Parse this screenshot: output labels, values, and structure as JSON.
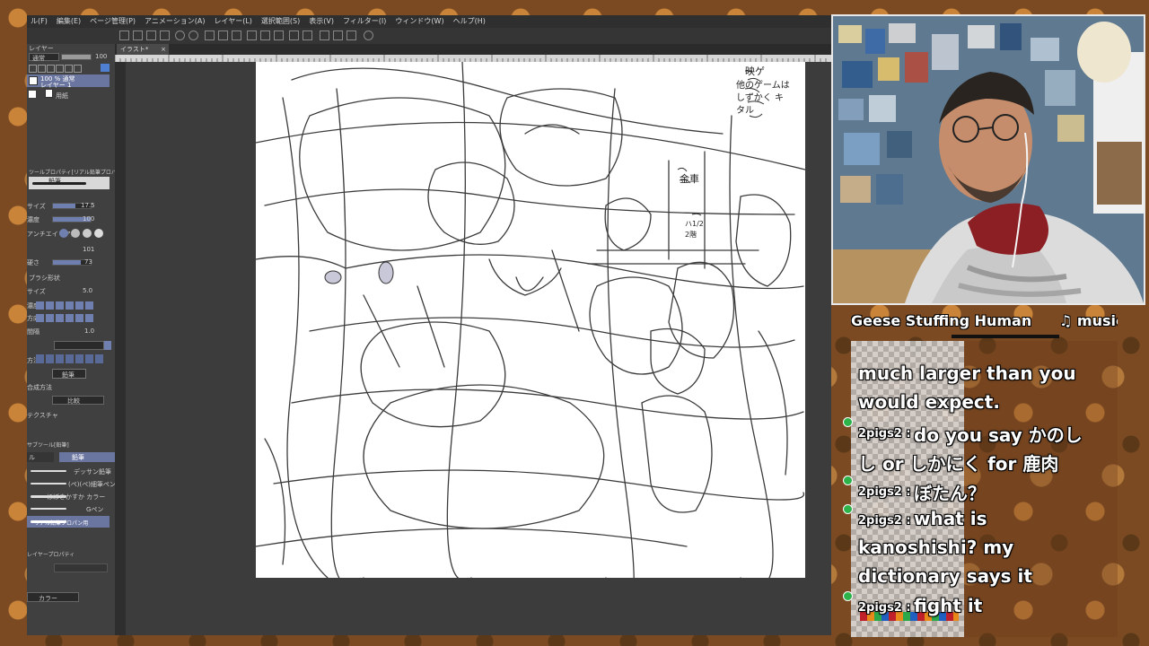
{
  "menu": {
    "items": [
      "ル(F)",
      "編集(E)",
      "ページ管理(P)",
      "アニメーション(A)",
      "レイヤー(L)",
      "選択範囲(S)",
      "表示(V)",
      "フィルター(I)",
      "ウィンドウ(W)",
      "ヘルプ(H)"
    ]
  },
  "document_tab": {
    "label": "イラスト*",
    "close": "×"
  },
  "left_panel": {
    "layer_header": "レイヤー",
    "blend_mode": "通常",
    "opacity_value": "100",
    "layer1_name": "100 % 通常",
    "layer1_sub": "レイヤー 1",
    "layer2_name": "用紙",
    "tool_property_header": "ツールプロパティ[リアル鉛筆プロパ...]",
    "brush_name": "鉛筆",
    "size_label": "サイズ",
    "size_value": "17.5",
    "density_label": "濃度",
    "density_value": "100",
    "anti_label": "アンチエイリアス",
    "val_101": "101",
    "hardness_label": "硬さ",
    "hardness_value": "73",
    "stabilize_label": "ブラシ形状",
    "size2_label": "サイズ",
    "size2_value": "5.0",
    "density2_label": "濃度",
    "direction_label": "方向",
    "interval_label": "間隔",
    "interval_value": "1.0",
    "method_label": "方法",
    "pencil_button": "鉛筆",
    "blend_method_label": "合成方法",
    "blend_method_value": "比較",
    "texture_label": "テクスチャ",
    "sub_tool_header": "サブツール[鉛筆]",
    "sub_tab1": "ル",
    "sub_tab2": "鉛筆",
    "brush1": "デッサン鉛筆",
    "brush2": "(ペ)(ペ)細筆ペン",
    "brush3": "ほぼきかすか カラー",
    "brush4": "Gペン",
    "brush5": "リアル鉛筆プロパン用",
    "layer_property_header": "レイヤープロパティ",
    "color_label": "カラー"
  },
  "canvas": {
    "note_top": "映ゲ",
    "note_text": "他のゲームは しずかく キタル",
    "note_right": "金車",
    "note_small": "ハ1/2 2階"
  },
  "stream_overlay": {
    "title": "Geese Stuffing Human",
    "music": "♫ music"
  },
  "chat": [
    {
      "type": "text",
      "text": "much larger than you"
    },
    {
      "type": "text",
      "text": "would expect."
    },
    {
      "type": "msg",
      "user": "2pigs2 :",
      "text": "do you say かのし"
    },
    {
      "type": "text",
      "text": "し or しかにく for 鹿肉"
    },
    {
      "type": "msg",
      "user": "2pigs2 :",
      "text": "ぼたん？"
    },
    {
      "type": "msg",
      "user": "2pigs2 :",
      "text": "what is"
    },
    {
      "type": "text",
      "text": "kanoshishi? my"
    },
    {
      "type": "text",
      "text": "dictionary says it"
    },
    {
      "type": "msg",
      "user": "2pigs2 :",
      "text": "fight it"
    }
  ],
  "colors": {
    "accent": "#6f7fb0",
    "chat_badge": "#2db34a",
    "canvas": "#ffffff",
    "app_bg": "#3b3b3b"
  }
}
